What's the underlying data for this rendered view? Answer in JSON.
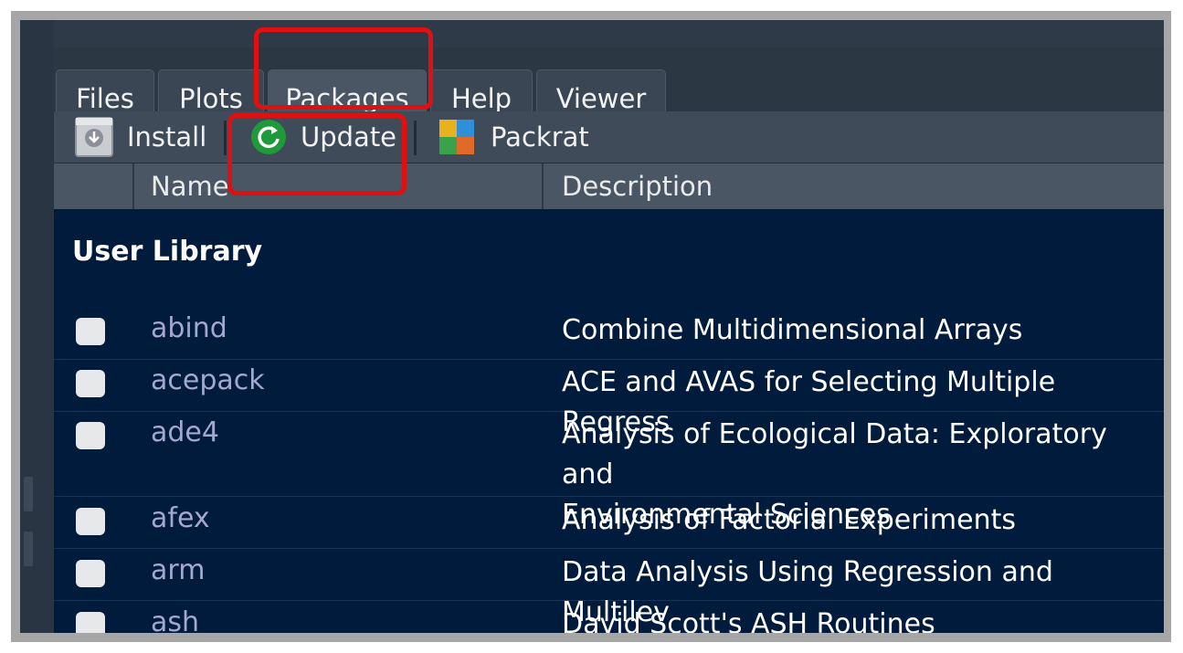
{
  "tabs": [
    {
      "label": "Files"
    },
    {
      "label": "Plots"
    },
    {
      "label": "Packages"
    },
    {
      "label": "Help"
    },
    {
      "label": "Viewer"
    }
  ],
  "toolbar": {
    "install_label": "Install",
    "update_label": "Update",
    "packrat_label": "Packrat"
  },
  "columns": {
    "name": "Name",
    "description": "Description"
  },
  "library": {
    "title": "User Library",
    "packages": [
      {
        "name": "abind",
        "description": "Combine Multidimensional Arrays"
      },
      {
        "name": "acepack",
        "description": "ACE and AVAS for Selecting Multiple Regress"
      },
      {
        "name": "ade4",
        "description": "Analysis of Ecological Data: Exploratory and\nEnvironmental Sciences"
      },
      {
        "name": "afex",
        "description": "Analysis of Factorial Experiments"
      },
      {
        "name": "arm",
        "description": "Data Analysis Using Regression and Multilev"
      },
      {
        "name": "ash",
        "description": "David Scott's ASH Routines"
      }
    ]
  },
  "colors": {
    "highlight": "#e01010",
    "update_icon": "#1f9a3a",
    "package_link": "#a3a8cf"
  }
}
